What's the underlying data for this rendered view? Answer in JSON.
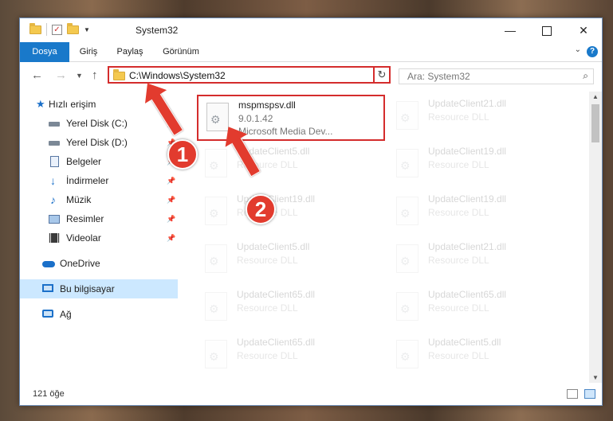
{
  "window": {
    "title": "System32"
  },
  "ribbon": {
    "tabs": [
      "Dosya",
      "Giriş",
      "Paylaş",
      "Görünüm"
    ]
  },
  "nav": {
    "address": "C:\\Windows\\System32",
    "search_placeholder": "Ara: System32"
  },
  "sidebar": {
    "items": [
      {
        "label": "Hızlı erişim",
        "icon": "star-icon"
      },
      {
        "label": "Yerel Disk (C:)",
        "icon": "drive-icon"
      },
      {
        "label": "Yerel Disk (D:)",
        "icon": "drive-icon"
      },
      {
        "label": "Belgeler",
        "icon": "document-icon"
      },
      {
        "label": "İndirmeler",
        "icon": "download-icon"
      },
      {
        "label": "Müzik",
        "icon": "music-icon"
      },
      {
        "label": "Resimler",
        "icon": "pictures-icon"
      },
      {
        "label": "Videolar",
        "icon": "video-icon"
      },
      {
        "label": "OneDrive",
        "icon": "cloud-icon"
      },
      {
        "label": "Bu bilgisayar",
        "icon": "computer-icon"
      },
      {
        "label": "Ağ",
        "icon": "network-icon"
      }
    ]
  },
  "files": {
    "highlighted": {
      "name": "mspmspsv.dll",
      "version": "9.0.1.42",
      "description": "Microsoft Media Dev..."
    },
    "items": [
      {
        "name": "UpdateClient21.dll",
        "type": "Resource DLL"
      },
      {
        "name": "UpdateClient5.dll",
        "type": "Resource DLL"
      },
      {
        "name": "UpdateClient19.dll",
        "type": "Resource DLL"
      },
      {
        "name": "UpdateClient19.dll",
        "type": "Resource DLL"
      },
      {
        "name": "UpdateClient19.dll",
        "type": "Resource DLL"
      },
      {
        "name": "UpdateClient5.dll",
        "type": "Resource DLL"
      },
      {
        "name": "UpdateClient21.dll",
        "type": "Resource DLL"
      },
      {
        "name": "UpdateClient65.dll",
        "type": "Resource DLL"
      },
      {
        "name": "UpdateClient65.dll",
        "type": "Resource DLL"
      },
      {
        "name": "UpdateClient65.dll",
        "type": "Resource DLL"
      },
      {
        "name": "UpdateClient5.dll",
        "type": "Resource DLL"
      }
    ]
  },
  "status": {
    "count": "121 öğe"
  },
  "annotations": {
    "step1": "1",
    "step2": "2",
    "color": "#e23b2e"
  }
}
